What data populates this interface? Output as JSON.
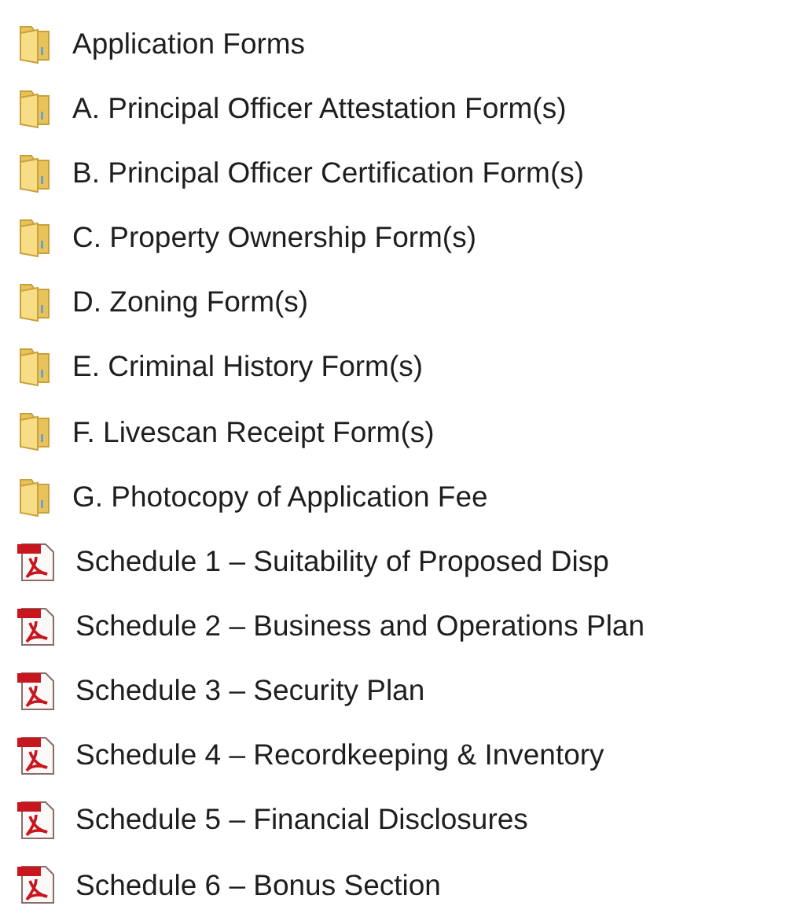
{
  "files": [
    {
      "kind": "folder",
      "name": "Application Forms"
    },
    {
      "kind": "folder",
      "name": "A. Principal Officer Attestation Form(s)"
    },
    {
      "kind": "folder",
      "name": "B. Principal Officer Certification Form(s)"
    },
    {
      "kind": "folder",
      "name": "C. Property Ownership Form(s)"
    },
    {
      "kind": "folder",
      "name": "D. Zoning Form(s)"
    },
    {
      "kind": "folder",
      "name": "E. Criminal History Form(s)"
    },
    {
      "kind": "folder",
      "name": "F. Livescan Receipt Form(s)"
    },
    {
      "kind": "folder",
      "name": "G. Photocopy of Application Fee"
    },
    {
      "kind": "pdf",
      "name": "Schedule 1 – Suitability of Proposed Disp"
    },
    {
      "kind": "pdf",
      "name": "Schedule 2 – Business and Operations Plan"
    },
    {
      "kind": "pdf",
      "name": "Schedule 3 – Security Plan"
    },
    {
      "kind": "pdf",
      "name": "Schedule 4 – Recordkeeping & Inventory"
    },
    {
      "kind": "pdf",
      "name": "Schedule 5 – Financial Disclosures"
    },
    {
      "kind": "pdf",
      "name": "Schedule 6 – Bonus Section"
    }
  ]
}
